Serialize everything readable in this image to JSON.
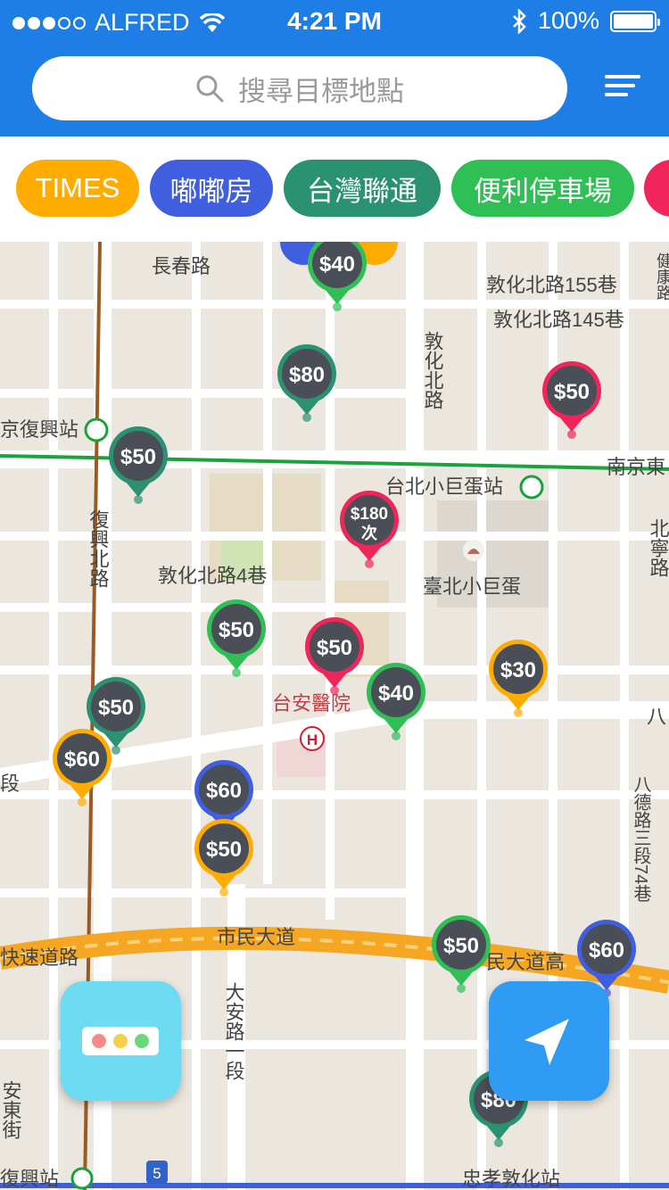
{
  "status_bar": {
    "carrier": "ALFRED",
    "time": "4:21 PM",
    "battery": "100%"
  },
  "search": {
    "placeholder": "搜尋目標地點"
  },
  "filters": [
    {
      "label": "TIMES",
      "color": "#ffac00"
    },
    {
      "label": "嘟嘟房",
      "color": "#3f5ee0"
    },
    {
      "label": "台灣聯通",
      "color": "#2a9171"
    },
    {
      "label": "便利停車場",
      "color": "#2fbf55"
    },
    {
      "label": "",
      "color": "#f0255a"
    }
  ],
  "map_labels": {
    "changchun_rd": "長春路",
    "dunhua_n_155": "敦化北路155巷",
    "dunhua_n_145": "敦化北路145巷",
    "dunhua_n_rd": "敦化北路",
    "fuxing_station": "京復興站",
    "nanjing_e": "南京東",
    "arena_station": "台北小巨蛋站",
    "fuxing_n_rd": "復興北路",
    "dunhua_n_4": "敦化北路4巷",
    "taipei_arena": "臺北小巨蛋",
    "beining": "北寧路",
    "taian_hospital": "台安醫院",
    "hospital_mark": "H",
    "ba": "八",
    "duan": "段",
    "bade_rd": "八德路三段74巷",
    "expressway": "快速道路",
    "civic_blvd": "市民大道",
    "civic_blvd_2": "民大道高",
    "daan_rd": "大安路一段",
    "andong_st": "安東街",
    "fuxing_station_2": "復興站",
    "zhongxiao_station": "忠孝敦化站",
    "route_5": "5",
    "corner_top": "健康路"
  },
  "markers": [
    {
      "price": "$40",
      "color": "#2fbf55"
    },
    {
      "price": "$80",
      "color": "#2a9171"
    },
    {
      "price": "$50",
      "color": "#f0255a"
    },
    {
      "price": "$50",
      "color": "#2a9171"
    },
    {
      "price": "$180",
      "sub": "次",
      "color": "#f0255a"
    },
    {
      "price": "$50",
      "color": "#2fbf55"
    },
    {
      "price": "$50",
      "color": "#f0255a"
    },
    {
      "price": "$40",
      "color": "#2fbf55"
    },
    {
      "price": "$30",
      "color": "#ffac00"
    },
    {
      "price": "$50",
      "color": "#2a9171"
    },
    {
      "price": "$60",
      "color": "#ffac00"
    },
    {
      "price": "$60",
      "color": "#3f5ee0"
    },
    {
      "price": "$50",
      "color": "#ffac00"
    },
    {
      "price": "$50",
      "color": "#2fbf55"
    },
    {
      "price": "$60",
      "color": "#3f5ee0"
    },
    {
      "price": "$80",
      "color": "#2a9171"
    }
  ],
  "colors": {
    "header": "#1f7ee6",
    "map_bg": "#ebe7df",
    "road": "#ffffff",
    "highway": "#f5a623",
    "fab_left": "#6ddcf2",
    "fab_right": "#2f9bf2"
  },
  "icons": {
    "search": "search-icon",
    "menu": "sort-menu-icon",
    "legend": "legend-dots-icon",
    "locate": "navigation-arrow-icon"
  }
}
